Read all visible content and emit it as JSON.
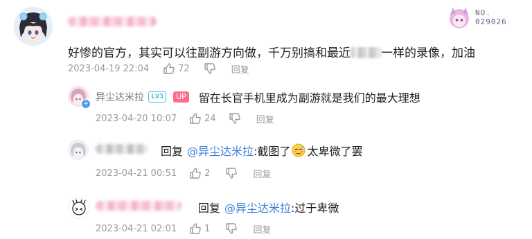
{
  "root_comment": {
    "text_before": "好惨的官方，其实可以往副游方向做，千万别搞和最近",
    "text_after": "一样的录像，加油",
    "timestamp": "2023-04-19 22:04",
    "likes": "72",
    "reply_label": "回复",
    "fan_badge": {
      "prefix": "NO.",
      "number": "029026"
    }
  },
  "replies": [
    {
      "username": "异尘达米拉",
      "level": "LV3",
      "role_badge": "UP",
      "text": "留在长官手机里成为副游就是我们的最大理想",
      "timestamp": "2023-04-20 10:07",
      "likes": "24",
      "reply_label": "回复"
    },
    {
      "reply_prefix": "回复",
      "mention": "@异尘达米拉",
      "text_before": ":截图了",
      "emoji": "blush-emoji",
      "text_after": "太卑微了罢",
      "timestamp": "2023-04-21 00:51",
      "likes": "2",
      "reply_label": "回复"
    },
    {
      "reply_prefix": "回复",
      "mention": "@异尘达米拉",
      "text": ":过于卑微",
      "timestamp": "2023-04-21 02:01",
      "likes": "1",
      "reply_label": "回复"
    }
  ],
  "colors": {
    "mention": "#3d82d9",
    "meta": "#9a9a9a",
    "up_badge": "#ff6b8a",
    "level_badge": "#4fb6e8"
  }
}
